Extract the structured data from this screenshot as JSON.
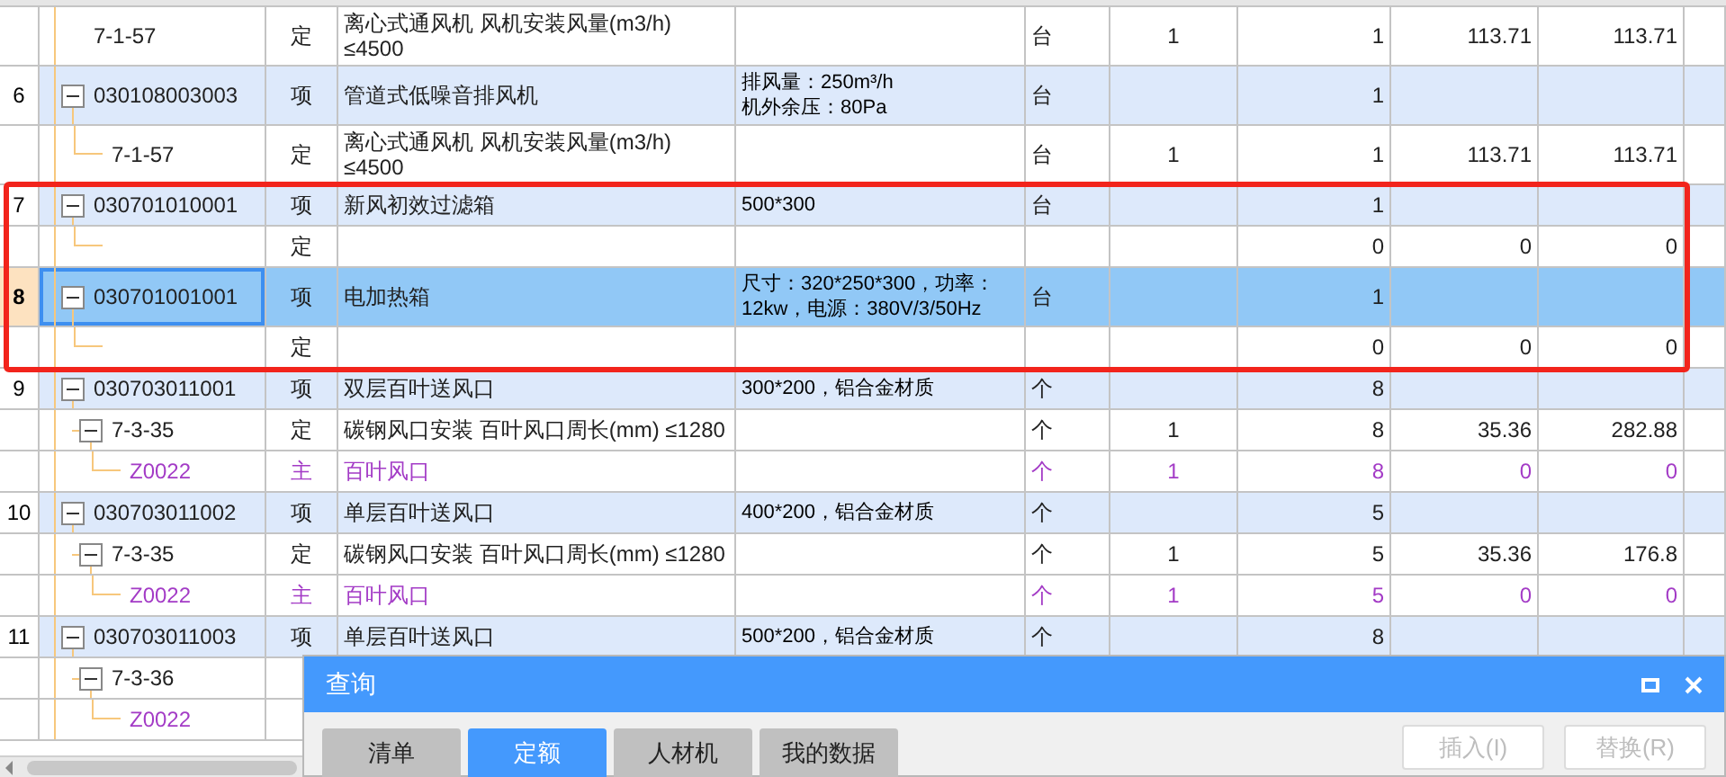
{
  "rows": [
    {
      "children": [
        {
          "code": "7-1-57",
          "type": "定",
          "name": "离心式通风机 风机安装风量(m3/h)\n≤4500",
          "unit": "台",
          "coef": "1",
          "quantity": "1",
          "price": "113.71",
          "total": "113.71",
          "kind": "quota"
        }
      ]
    },
    {
      "number": "6",
      "code": "030108003003",
      "type": "项",
      "name": "管道式低噪音排风机",
      "feature": "排风量：250m³/h\n机外余压：80Pa",
      "unit": "台",
      "quantity": "1",
      "kind": "item",
      "selected": false,
      "expanded": true,
      "children": [
        {
          "code": "7-1-57",
          "type": "定",
          "name": "离心式通风机 风机安装风量(m3/h)\n≤4500",
          "unit": "台",
          "coef": "1",
          "quantity": "1",
          "price": "113.71",
          "total": "113.71",
          "kind": "quota"
        }
      ]
    },
    {
      "number": "7",
      "code": "030701010001",
      "type": "项",
      "name": "新风初效过滤箱",
      "feature": "500*300",
      "unit": "台",
      "quantity": "1",
      "kind": "item",
      "selected": false,
      "expanded": true,
      "children": [
        {
          "type": "定",
          "quantity": "0",
          "price": "0",
          "total": "0",
          "kind": "quota"
        }
      ]
    },
    {
      "number": "8",
      "code": "030701001001",
      "type": "项",
      "name": "电加热箱",
      "feature": "尺寸：320*250*300，功率：\n12kw，电源：380V/3/50Hz",
      "unit": "台",
      "quantity": "1",
      "kind": "item",
      "selected": true,
      "expanded": true,
      "children": [
        {
          "type": "定",
          "quantity": "0",
          "price": "0",
          "total": "0",
          "kind": "quota"
        }
      ]
    },
    {
      "number": "9",
      "code": "030703011001",
      "type": "项",
      "name": "双层百叶送风口",
      "feature": "300*200，铝合金材质",
      "unit": "个",
      "quantity": "8",
      "kind": "item",
      "selected": false,
      "expanded": true,
      "children": [
        {
          "code": "7-3-35",
          "type": "定",
          "name": "碳钢风口安装 百叶风口周长(mm) ≤1280",
          "unit": "个",
          "coef": "1",
          "quantity": "8",
          "price": "35.36",
          "total": "282.88",
          "kind": "quota",
          "expanded": true,
          "children": [
            {
              "code": "Z0022",
              "type": "主",
              "name": "百叶风口",
              "unit": "个",
              "coef": "1",
              "quantity": "8",
              "price": "0",
              "total": "0",
              "kind": "material"
            }
          ]
        }
      ]
    },
    {
      "number": "10",
      "code": "030703011002",
      "type": "项",
      "name": "单层百叶送风口",
      "feature": "400*200，铝合金材质",
      "unit": "个",
      "quantity": "5",
      "kind": "item",
      "selected": false,
      "expanded": true,
      "children": [
        {
          "code": "7-3-35",
          "type": "定",
          "name": "碳钢风口安装 百叶风口周长(mm) ≤1280",
          "unit": "个",
          "coef": "1",
          "quantity": "5",
          "price": "35.36",
          "total": "176.8",
          "kind": "quota",
          "expanded": true,
          "children": [
            {
              "code": "Z0022",
              "type": "主",
              "name": "百叶风口",
              "unit": "个",
              "coef": "1",
              "quantity": "5",
              "price": "0",
              "total": "0",
              "kind": "material"
            }
          ]
        }
      ]
    },
    {
      "number": "11",
      "code": "030703011003",
      "type": "项",
      "name": "单层百叶送风口",
      "feature": "500*200，铝合金材质",
      "unit": "个",
      "quantity": "8",
      "kind": "item",
      "selected": false,
      "expanded": true,
      "children": [
        {
          "code": "7-3-36",
          "kind": "quota",
          "expanded": true,
          "children": [
            {
              "code": "Z0022",
              "kind": "material"
            }
          ]
        }
      ]
    }
  ],
  "dialog": {
    "title": "查询",
    "tabs": [
      {
        "label": "清单",
        "selected": false
      },
      {
        "label": "定额",
        "selected": true
      },
      {
        "label": "人材机",
        "selected": false
      },
      {
        "label": "我的数据",
        "selected": false
      }
    ],
    "buttons": [
      {
        "label": "插入(I)",
        "disabled": true
      },
      {
        "label": "替换(R)",
        "disabled": true
      }
    ]
  }
}
